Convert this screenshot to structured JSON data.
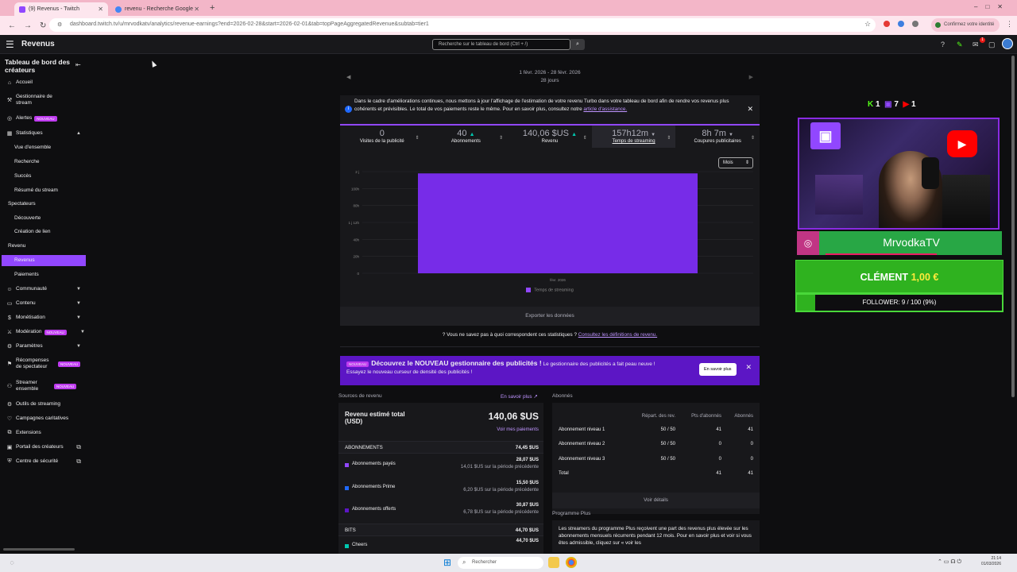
{
  "browser": {
    "tabs": [
      {
        "label": "(9) Revenus - Twitch",
        "active": true
      },
      {
        "label": "revenu - Recherche Google",
        "active": false
      }
    ],
    "new_tab": "+",
    "url": "dashboard.twitch.tv/u/mrvodkatv/analytics/revenue-earnings?end=2026-02-28&start=2026-02-01&tab=topPageAggregatedRevenue&subtab=tier1",
    "profile_pill": "Confirmez votre identité"
  },
  "topbar": {
    "title": "Revenus",
    "search_placeholder": "Recherche sur le tableau de bord (Ctrl + /)",
    "notif_count": "1"
  },
  "sidebar": {
    "title": "Tableau de bord des créateurs",
    "items": [
      {
        "label": "Accueil",
        "icon": "home-icon"
      },
      {
        "label": "Gestionnaire de stream",
        "icon": "stream-manager-icon"
      },
      {
        "label": "Alertes",
        "icon": "alert-icon",
        "badge": "NOUVEAU"
      },
      {
        "label": "Statistiques",
        "icon": "stats-icon"
      },
      {
        "label": "Vue d'ensemble"
      },
      {
        "label": "Recherche"
      },
      {
        "label": "Succès"
      },
      {
        "label": "Résumé du stream"
      },
      {
        "label": "Spectateurs"
      },
      {
        "label": "Découverte"
      },
      {
        "label": "Création de lien"
      },
      {
        "label": "Revenu"
      },
      {
        "label": "Revenus"
      },
      {
        "label": "Paiements"
      },
      {
        "label": "Communauté",
        "icon": "community-icon"
      },
      {
        "label": "Contenu",
        "icon": "content-icon"
      },
      {
        "label": "Monétisation",
        "icon": "monetization-icon"
      },
      {
        "label": "Modération",
        "icon": "moderation-icon",
        "badge": "NOUVEAU"
      },
      {
        "label": "Paramètres",
        "icon": "settings-icon"
      },
      {
        "label": "Récompenses de spectateur",
        "icon": "rewards-icon",
        "badge": "NOUVEAU"
      },
      {
        "label": "Streamer ensemble",
        "icon": "together-icon",
        "badge": "NOUVEAU"
      },
      {
        "label": "Outils de streaming",
        "icon": "tools-icon"
      },
      {
        "label": "Campagnes caritatives",
        "icon": "charity-icon"
      },
      {
        "label": "Extensions",
        "icon": "extensions-icon"
      },
      {
        "label": "Portail des créateurs",
        "icon": "portal-icon"
      },
      {
        "label": "Centre de sécurité",
        "icon": "safety-icon"
      }
    ]
  },
  "main": {
    "date_range": "1 févr. 2026 - 28 févr. 2026",
    "days": "28 jours",
    "info_text": "Dans le cadre d'améliorations continues, nous mettons à jour l'affichage de l'estimation de votre revenu Turbo dans votre tableau de bord afin de rendre vos revenus plus cohérents et prévisibles. Le total de vos paiements reste le même. Pour en savoir plus, consultez notre",
    "info_link": "article d'assistance.",
    "kpis": [
      {
        "value": "0",
        "label": "Visites de la publicité",
        "trend": ""
      },
      {
        "value": "40",
        "label": "Abonnements",
        "trend": "▲"
      },
      {
        "value": "140,06 $US",
        "label": "Revenu",
        "trend": "▲"
      },
      {
        "value": "157h12m",
        "label": "Temps de streaming",
        "trend": "▼"
      },
      {
        "value": "8h 7m",
        "label": "Coupures publicitaires",
        "trend": "▼"
      }
    ],
    "granularity": "Mois",
    "legend": "Temps de streaming",
    "export": "Exporter les données",
    "help_text": "Vous ne savez pas à quoi correspondent ces statistiques ?",
    "help_link": "Consultez les définitions de revenu.",
    "promo": {
      "badge": "NOUVEAU",
      "title": "Découvrez le NOUVEAU gestionnaire des publicités !",
      "text": " Le gestionnaire des publicités a fait peau neuve !",
      "text2": "Essayez le nouveau curseur de densité des publicités !",
      "button": "En savoir plus"
    },
    "sources": {
      "header": "Sources de revenu",
      "more": "En savoir plus",
      "total_label": "Revenu estimé total (USD)",
      "total_value": "140,06 $US",
      "payments_link": "Voir mes paiements",
      "abo_label": "ABONNEMENTS",
      "abo_value": "74,45 $US",
      "subs": [
        {
          "name": "Abonnements payés",
          "v1": "28,07 $US",
          "v2": "14,01 $US sur la période précédente",
          "color": "#9147ff"
        },
        {
          "name": "Abonnements Prime",
          "v1": "15,50 $US",
          "v2": "6,20 $US sur la période précédente",
          "color": "#1f69ff"
        },
        {
          "name": "Abonnements offerts",
          "v1": "30,87 $US",
          "v2": "6,78 $US sur la période précédente",
          "color": "#5c16c5"
        }
      ],
      "bits_label": "BITS",
      "bits_value": "44,70 $US",
      "cheers_label": "Cheers",
      "cheers_value": "44,70 $US"
    },
    "subscribers": {
      "header": "Abonnés",
      "cols": [
        "Répart. des rev.",
        "Pts d'abonnés",
        "Abonnés"
      ],
      "rows": [
        {
          "name": "Abonnement niveau 1",
          "split": "50 / 50",
          "pts": "41",
          "subs": "41"
        },
        {
          "name": "Abonnement niveau 2",
          "split": "50 / 50",
          "pts": "0",
          "subs": "0"
        },
        {
          "name": "Abonnement niveau 3",
          "split": "50 / 50",
          "pts": "0",
          "subs": "0"
        }
      ],
      "total": {
        "name": "Total",
        "pts": "41",
        "subs": "41"
      },
      "details": "Voir détails"
    },
    "plus": {
      "header": "Programme Plus",
      "text": "Les streamers du programme Plus reçoivent une part des revenus plus élevée sur les abonnements mensuels récurrents pendant 12 mois. Pour en savoir plus et voir si vous êtes admissible, cliquez sur « voir les"
    }
  },
  "chart_data": {
    "type": "bar",
    "categories": [
      "févr. 2026"
    ],
    "series": [
      {
        "name": "Temps de streaming",
        "values": [
          157.2
        ]
      }
    ],
    "ylabel": "",
    "yticks": [
      "0",
      "20h",
      "40h",
      "1 j 12h",
      "80h",
      "100h",
      "2 j"
    ],
    "ylim": [
      0,
      160
    ],
    "color": "#772ce8"
  },
  "overlay": {
    "kick": "1",
    "twitch": "7",
    "youtube": "1",
    "name": "MrvodkaTV",
    "goal_name": "CLÉMENT",
    "goal_amount": "1,00 €",
    "follower": "FOLLOWER: 9 / 100 (9%)",
    "follower_progress": 0.09
  },
  "taskbar": {
    "search": "Rechercher",
    "clock_time": "21:14",
    "clock_date": "01/03/2026"
  }
}
